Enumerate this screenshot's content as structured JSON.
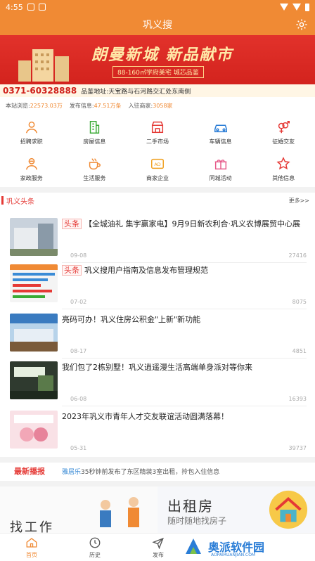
{
  "status": {
    "time": "4:55"
  },
  "app": {
    "title": "巩义搜"
  },
  "banner": {
    "title": "朗曼新城 新品献市",
    "subtitle": "88-160㎡学府美宅 城芯品鉴",
    "phone": "0371-60328888",
    "address": "品鉴地址:天宝路与石河路交汇处东南侧"
  },
  "stats": {
    "posted_label": "本站浏览:",
    "posted_value": "22573.03万",
    "info_label": "发布信息:",
    "info_value": "47.51万条",
    "members_label": "入驻商家:",
    "members_value": "3058家"
  },
  "categories": [
    {
      "label": "招聘求职",
      "icon": "person-icon",
      "color": "#f08a34"
    },
    {
      "label": "房屋信息",
      "icon": "building-icon",
      "color": "#3aaa35"
    },
    {
      "label": "二手市场",
      "icon": "shop-icon",
      "color": "#e53935"
    },
    {
      "label": "车辆信息",
      "icon": "car-icon",
      "color": "#2a7dd6"
    },
    {
      "label": "征婚交友",
      "icon": "gender-icon",
      "color": "#e53935"
    },
    {
      "label": "家政服务",
      "icon": "broom-icon",
      "color": "#f08a34"
    },
    {
      "label": "生活服务",
      "icon": "cup-icon",
      "color": "#f08a34"
    },
    {
      "label": "商家企业",
      "icon": "ad-icon",
      "color": "#f0a020"
    },
    {
      "label": "同城活动",
      "icon": "gift-icon",
      "color": "#e65a8a"
    },
    {
      "label": "其他信息",
      "icon": "star-icon",
      "color": "#e53935"
    }
  ],
  "headlines": {
    "title": "巩义头条",
    "more": "更多>>"
  },
  "news": [
    {
      "tag": "头条",
      "title": "【全城油礼 集宇赢家电】9月9日新农利合·巩义农博展贸中心展",
      "date": "09-08",
      "views": "27416"
    },
    {
      "tag": "头条",
      "title": "巩义搜用户指南及信息发布管理规范",
      "date": "07-02",
      "views": "8075"
    },
    {
      "tag": "",
      "title": "亮码可办！巩义住房公积金\"上新\"新功能",
      "date": "08-17",
      "views": "4851"
    },
    {
      "tag": "",
      "title": "我们包了2栋别墅！巩义逍遥漫生活高端单身派对等你来",
      "date": "06-08",
      "views": "16393"
    },
    {
      "tag": "",
      "title": "2023年巩义市青年人才交友联谊活动圆满落幕！",
      "date": "05-31",
      "views": "39737"
    }
  ],
  "ticker": {
    "label": "最新播报",
    "user": "雅居乐",
    "text": "35秒钟前发布了东区精装3室出租，拎包入住信息"
  },
  "promo": {
    "left_title": "找工作",
    "right_title": "出租房",
    "right_sub": "随时随地找房子"
  },
  "tabs": [
    {
      "label": "首页",
      "icon": "home-icon"
    },
    {
      "label": "历史",
      "icon": "clock-icon"
    },
    {
      "label": "发布",
      "icon": "send-icon"
    }
  ],
  "watermark": {
    "text": "奥派软件园",
    "sub": "AOPAIRUANJIAN.COM"
  },
  "colors": {
    "brand": "#f08a34",
    "accent": "#e53935"
  }
}
